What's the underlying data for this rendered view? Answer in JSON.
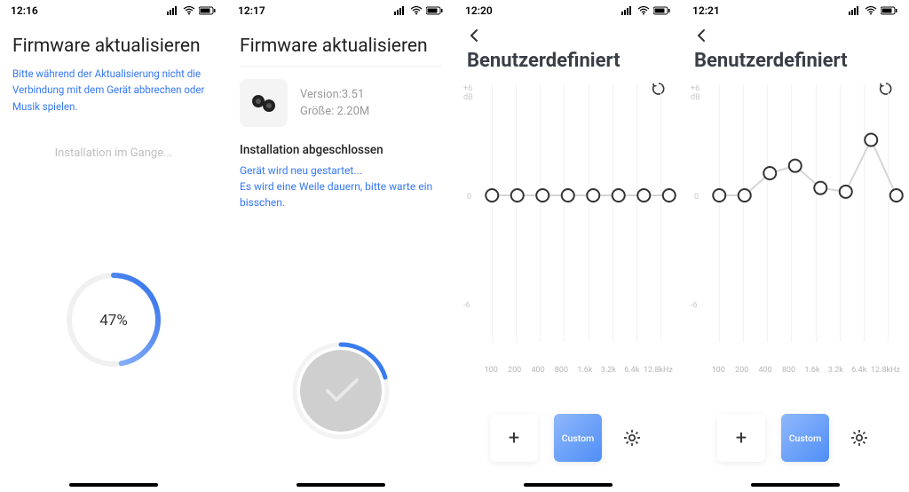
{
  "panels": [
    {
      "time": "12:16",
      "title": "Firmware aktualisieren",
      "warning": "Bitte während der Aktualisierung nicht die Verbindung mit dem Gerät abbrechen oder Musik spielen.",
      "status": "Installation im Gange...",
      "progress_pct": "47%"
    },
    {
      "time": "12:17",
      "title": "Firmware aktualisieren",
      "version_label": "Version:3.51",
      "size_label": "Größe: 2.20M",
      "done_title": "Installation abgeschlossen",
      "restart_msg": "Gerät wird neu gestartet...\nEs wird eine Weile dauern, bitte warte ein bisschen."
    },
    {
      "time": "12:20",
      "title": "Benutzerdefiniert",
      "ylabel_top": "+6\ndB",
      "ylabel_mid": "0",
      "ylabel_bot": "-6",
      "xlabels": [
        "100",
        "200",
        "400",
        "800",
        "1.6k",
        "3.2k",
        "6.4k",
        "12.8kHz"
      ],
      "add_label": "+",
      "custom_label": "Custom"
    },
    {
      "time": "12:21",
      "title": "Benutzerdefiniert",
      "ylabel_top": "+6\ndB",
      "ylabel_mid": "0",
      "ylabel_bot": "-6",
      "xlabels": [
        "100",
        "200",
        "400",
        "800",
        "1.6k",
        "3.2k",
        "6.4k",
        "12.8kHz"
      ],
      "add_label": "+",
      "custom_label": "Custom"
    }
  ],
  "chart_data": [
    {
      "type": "line",
      "title": "Benutzerdefiniert",
      "xlabel": "",
      "ylabel": "dB",
      "ylim": [
        -6,
        6
      ],
      "categories": [
        "100",
        "200",
        "400",
        "800",
        "1.6k",
        "3.2k",
        "6.4k",
        "12.8kHz"
      ],
      "values": [
        0,
        0,
        0,
        0,
        0,
        0,
        0,
        0
      ]
    },
    {
      "type": "line",
      "title": "Benutzerdefiniert",
      "xlabel": "",
      "ylabel": "dB",
      "ylim": [
        -6,
        6
      ],
      "categories": [
        "100",
        "200",
        "400",
        "800",
        "1.6k",
        "3.2k",
        "6.4k",
        "12.8kHz"
      ],
      "values": [
        0,
        0,
        1.2,
        1.6,
        0.4,
        0.2,
        3.0,
        0
      ]
    }
  ]
}
